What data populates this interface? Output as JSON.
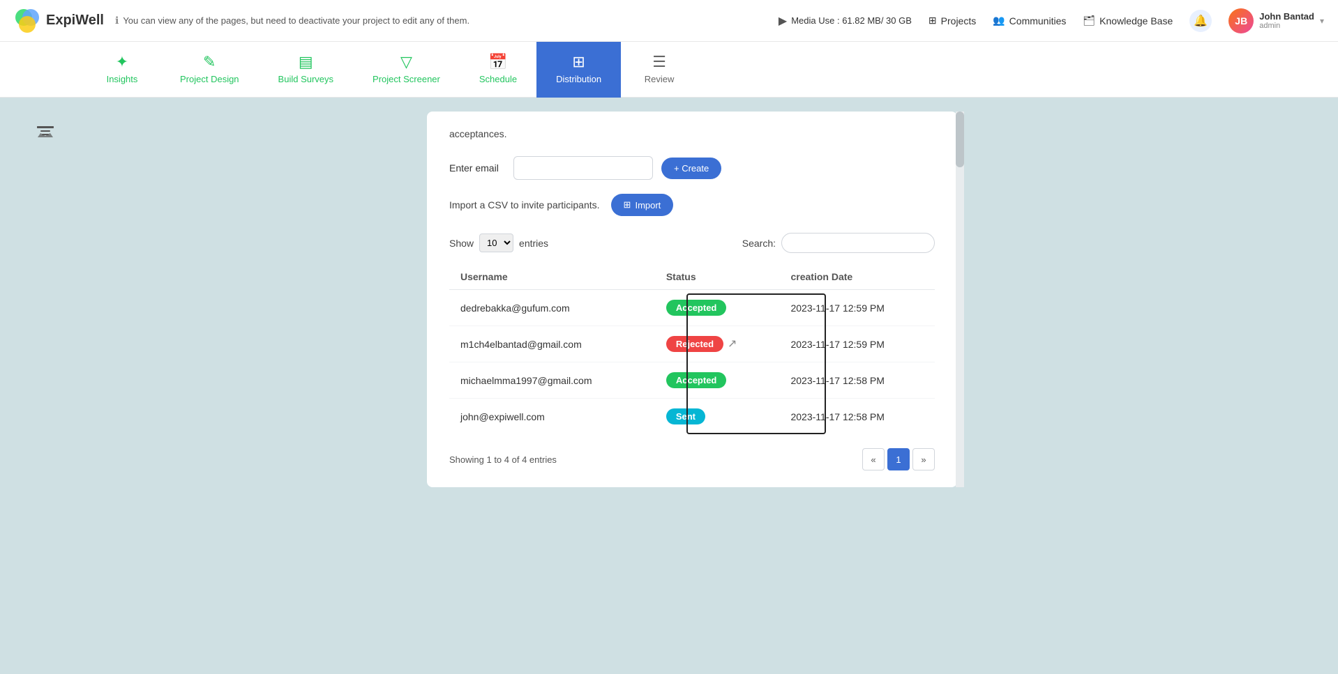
{
  "header": {
    "logo_text": "ExpiWell",
    "info_message": "You can view any of the pages, but need to deactivate your project to edit any of them.",
    "media_use_label": "Media Use : 61.82 MB/ 30 GB",
    "projects_label": "Projects",
    "communities_label": "Communities",
    "knowledge_base_label": "Knowledge Base",
    "user_name": "John Bantad",
    "user_role": "admin"
  },
  "tabs": [
    {
      "id": "insights",
      "label": "Insights",
      "icon": "✦",
      "active": false
    },
    {
      "id": "project-design",
      "label": "Project Design",
      "icon": "✎",
      "active": false
    },
    {
      "id": "build-surveys",
      "label": "Build Surveys",
      "icon": "▤",
      "active": false
    },
    {
      "id": "project-screener",
      "label": "Project Screener",
      "icon": "▽",
      "active": false
    },
    {
      "id": "schedule",
      "label": "Schedule",
      "icon": "📅",
      "active": false
    },
    {
      "id": "distribution",
      "label": "Distribution",
      "icon": "⊞",
      "active": true
    },
    {
      "id": "review",
      "label": "Review",
      "icon": "☰",
      "active": false
    }
  ],
  "content": {
    "acceptance_text": "acceptances.",
    "email_label": "Enter email",
    "email_placeholder": "",
    "create_btn_label": "+ Create",
    "import_text": "Import a CSV to invite participants.",
    "import_btn_label": "Import",
    "show_label": "Show",
    "show_value": "10",
    "entries_label": "entries",
    "search_label": "Search:",
    "search_placeholder": "",
    "table": {
      "columns": [
        "Username",
        "Status",
        "creation Date"
      ],
      "rows": [
        {
          "username": "dedrebakka@gufum.com",
          "status": "Accepted",
          "status_type": "accepted",
          "date": "2023-11-17 12:59 PM"
        },
        {
          "username": "m1ch4elbantad@gmail.com",
          "status": "Rejected",
          "status_type": "rejected",
          "date": "2023-11-17 12:59 PM"
        },
        {
          "username": "michaelmma1997@gmail.com",
          "status": "Accepted",
          "status_type": "accepted",
          "date": "2023-11-17 12:58 PM"
        },
        {
          "username": "john@expiwell.com",
          "status": "Sent",
          "status_type": "sent",
          "date": "2023-11-17 12:58 PM"
        }
      ]
    },
    "pagination": {
      "showing_text": "Showing 1 to 4 of 4 entries",
      "current_page": 1
    }
  },
  "colors": {
    "accent": "#3b6fd4",
    "accepted": "#22c55e",
    "rejected": "#ef4444",
    "sent": "#06b6d4",
    "tab_active_bg": "#3b6fd4"
  }
}
